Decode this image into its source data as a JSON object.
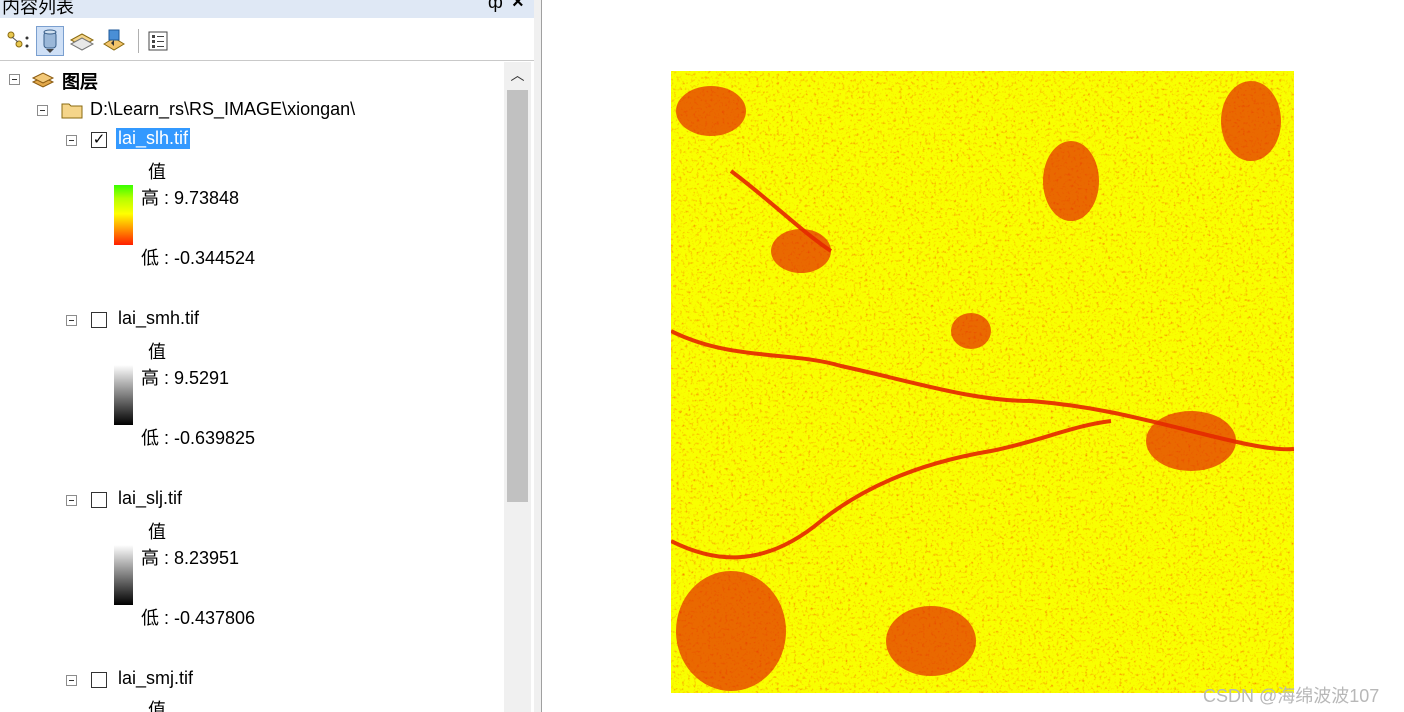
{
  "panel": {
    "title": "内容列表",
    "pin_glyph": "ф",
    "close_glyph": "×"
  },
  "toolbar": {
    "buttons": [
      {
        "name": "list-by-drawing-order-icon"
      },
      {
        "name": "list-by-source-icon"
      },
      {
        "name": "list-by-visibility-icon"
      },
      {
        "name": "list-by-selection-icon"
      },
      {
        "name": "options-icon"
      }
    ]
  },
  "tree": {
    "root_label": "图层",
    "folder_path": "D:\\Learn_rs\\RS_IMAGE\\xiongan\\",
    "layers": [
      {
        "name": "lai_slh.tif",
        "checked": true,
        "selected": true,
        "value_label": "值",
        "high": "高 : 9.73848",
        "low": "低 : -0.344524",
        "ramp": "color"
      },
      {
        "name": "lai_smh.tif",
        "checked": false,
        "selected": false,
        "value_label": "值",
        "high": "高 : 9.5291",
        "low": "低 : -0.639825",
        "ramp": "gray"
      },
      {
        "name": "lai_slj.tif",
        "checked": false,
        "selected": false,
        "value_label": "值",
        "high": "高 : 8.23951",
        "low": "低 : -0.437806",
        "ramp": "gray"
      },
      {
        "name": "lai_smj.tif",
        "checked": false,
        "selected": false,
        "value_label": "值",
        "high": "",
        "low": "",
        "ramp": "none"
      }
    ]
  },
  "map": {
    "colors": {
      "low": "#ff1e00",
      "mid": "#ffff00",
      "high": "#38ff00"
    }
  },
  "watermark": "CSDN @海绵波波107"
}
